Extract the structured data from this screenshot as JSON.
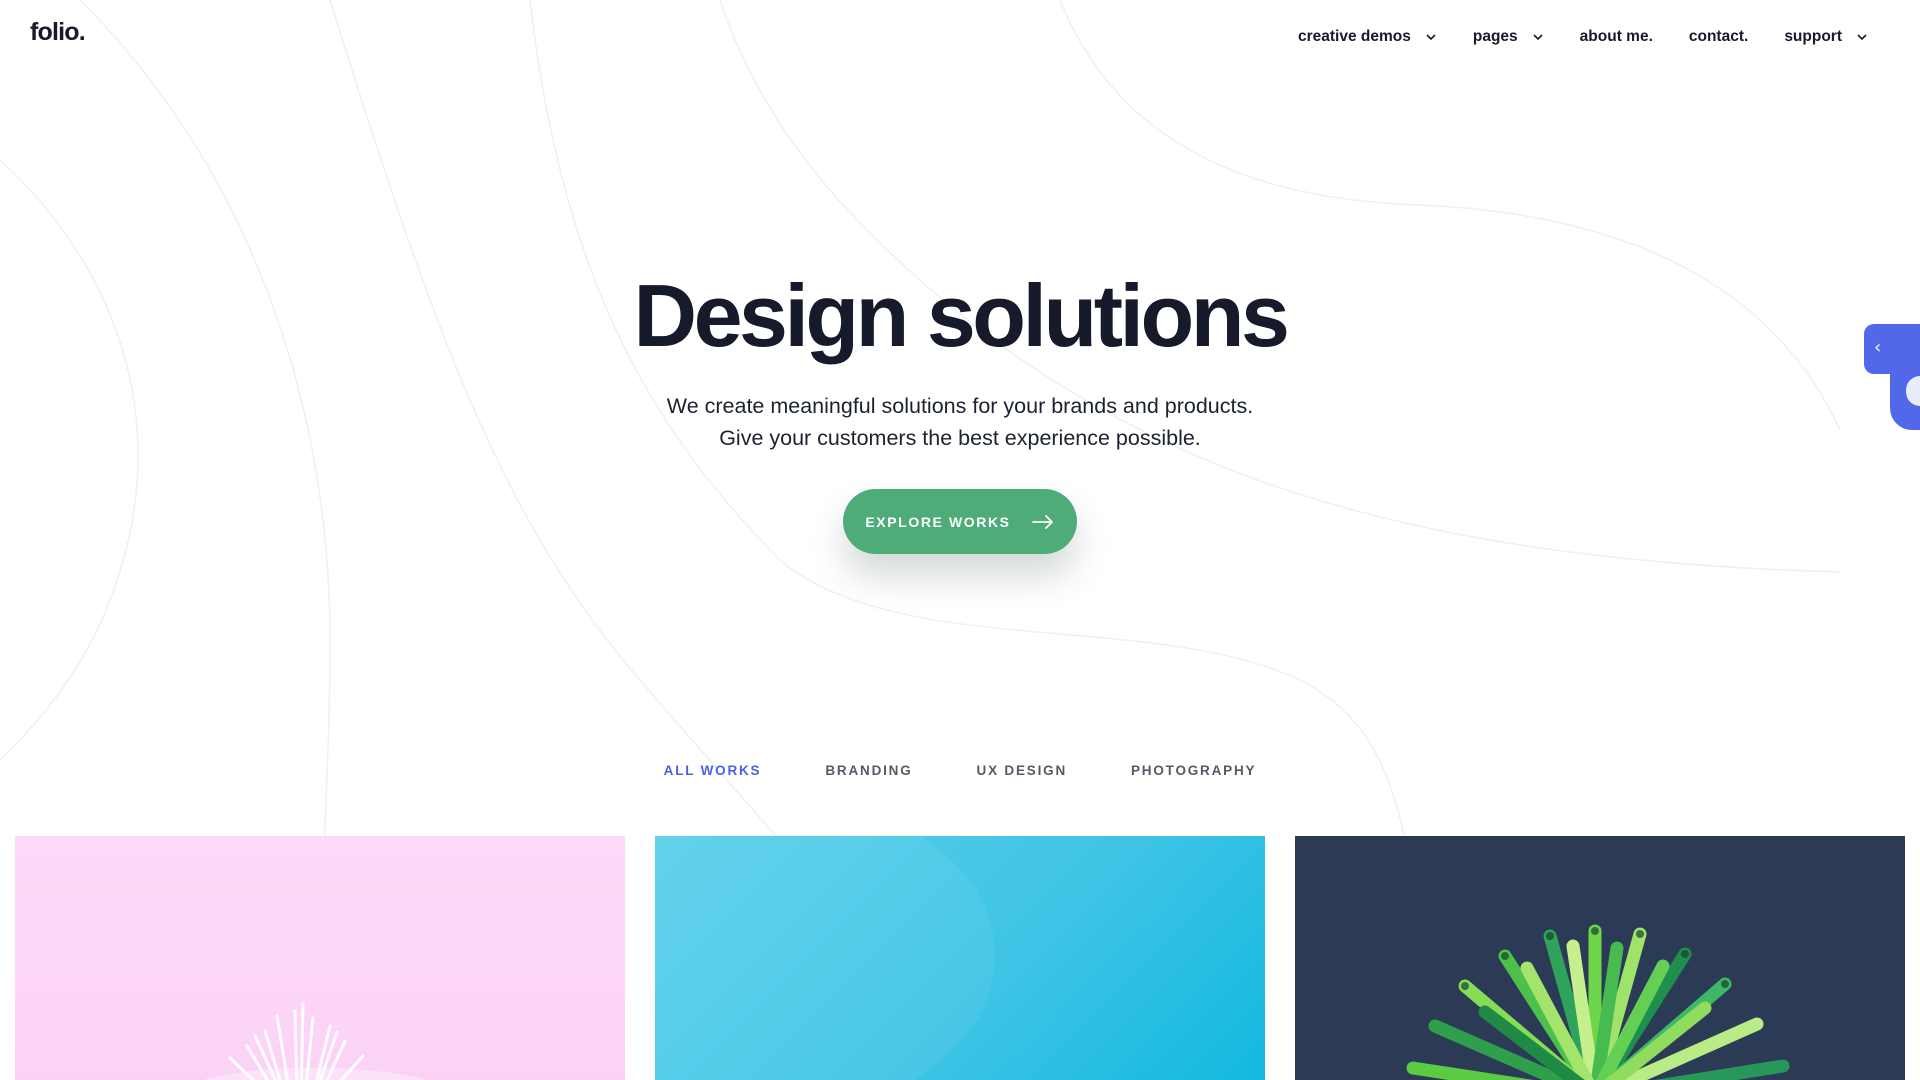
{
  "brand": {
    "logo": "folio."
  },
  "nav": {
    "items": [
      {
        "label": "creative demos",
        "has_dropdown": true
      },
      {
        "label": "pages",
        "has_dropdown": true
      },
      {
        "label": "about me.",
        "has_dropdown": false
      },
      {
        "label": "contact.",
        "has_dropdown": false
      },
      {
        "label": "support",
        "has_dropdown": true
      }
    ]
  },
  "hero": {
    "title": "Design solutions",
    "subtitle_line1": "We create meaningful solutions for your brands and products.",
    "subtitle_line2": "Give your customers the best experience possible.",
    "cta_label": "EXPLORE WORKS",
    "cta_icon": "arrow-right-icon"
  },
  "side_tab": {
    "icon": "chevron-left-icon",
    "glyph": "‹"
  },
  "filters": {
    "items": [
      {
        "label": "ALL WORKS",
        "active": true
      },
      {
        "label": "BRANDING",
        "active": false
      },
      {
        "label": "UX DESIGN",
        "active": false
      },
      {
        "label": "PHOTOGRAPHY",
        "active": false
      }
    ]
  },
  "portfolio": {
    "cards": [
      {
        "image": "pink-plant-photo"
      },
      {
        "image": "cyan-background-photo"
      },
      {
        "image": "green-straws-sphere-photo"
      }
    ]
  },
  "colors": {
    "text": "#161a2b",
    "accent_blue": "#4a62e2",
    "cta_green": "#4eac78",
    "side_tab_blue": "#5169e8",
    "card_pink": "#fdd9fa",
    "card_cyan": "#3fc4e6",
    "card_navy": "#2b3a55"
  }
}
